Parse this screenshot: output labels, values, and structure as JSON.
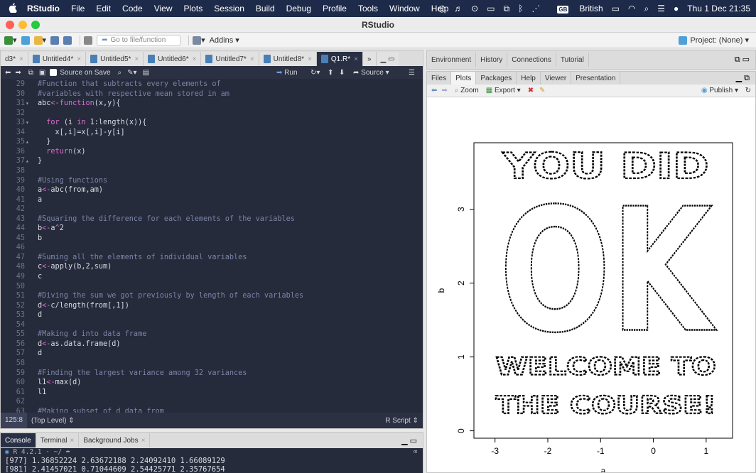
{
  "menubar": {
    "app": "RStudio",
    "items": [
      "File",
      "Edit",
      "Code",
      "View",
      "Plots",
      "Session",
      "Build",
      "Debug",
      "Profile",
      "Tools",
      "Window",
      "Help"
    ],
    "keyboard_badge": "GB",
    "keyboard": "British",
    "datetime": "Thu 1 Dec  21:35"
  },
  "window": {
    "title": "RStudio"
  },
  "toolbar": {
    "goto_placeholder": "Go to file/function",
    "addins": "Addins",
    "project": "Project: (None)"
  },
  "editor": {
    "tabs": [
      {
        "label": "d3*",
        "active": false
      },
      {
        "label": "Untitled4*",
        "active": false
      },
      {
        "label": "Untitled5*",
        "active": false
      },
      {
        "label": "Untitled6*",
        "active": false
      },
      {
        "label": "Untitled7*",
        "active": false
      },
      {
        "label": "Untitled8*",
        "active": false
      },
      {
        "label": "Q1.R*",
        "active": true
      }
    ],
    "more_tabs": "»",
    "source_on_save": "Source on Save",
    "run": "Run",
    "source": "Source",
    "lines": [
      {
        "n": "29",
        "text": "#Function that subtracts every elements of",
        "type": "cm"
      },
      {
        "n": "30",
        "text": "#variables with respective mean stored in am",
        "type": "cm"
      },
      {
        "n": "31",
        "text": "abc<-function(x,y){",
        "type": "fn",
        "fold": "▾"
      },
      {
        "n": "32",
        "text": "",
        "type": "plain"
      },
      {
        "n": "33",
        "text": "  for (i in 1:length(x)){",
        "type": "for",
        "fold": "▾"
      },
      {
        "n": "34",
        "text": "    x[,i]=x[,i]-y[i]",
        "type": "plain"
      },
      {
        "n": "35",
        "text": "  }",
        "type": "plain",
        "fold": "▴"
      },
      {
        "n": "36",
        "text": "  return(x)",
        "type": "plain"
      },
      {
        "n": "37",
        "text": "}",
        "type": "plain",
        "fold": "▴"
      },
      {
        "n": "38",
        "text": "",
        "type": "plain"
      },
      {
        "n": "39",
        "text": "#Using functions",
        "type": "cm"
      },
      {
        "n": "40",
        "text": "a<-abc(from,am)",
        "type": "plain"
      },
      {
        "n": "41",
        "text": "a",
        "type": "plain"
      },
      {
        "n": "42",
        "text": "",
        "type": "plain"
      },
      {
        "n": "43",
        "text": "#Squaring the difference for each elements of the variables",
        "type": "cm"
      },
      {
        "n": "44",
        "text": "b<-a^2",
        "type": "plain"
      },
      {
        "n": "45",
        "text": "b",
        "type": "plain"
      },
      {
        "n": "46",
        "text": "",
        "type": "plain"
      },
      {
        "n": "47",
        "text": "#Suming all the elements of individual variables",
        "type": "cm"
      },
      {
        "n": "48",
        "text": "c<-apply(b,2,sum)",
        "type": "plain"
      },
      {
        "n": "49",
        "text": "c",
        "type": "plain"
      },
      {
        "n": "50",
        "text": "",
        "type": "plain"
      },
      {
        "n": "51",
        "text": "#Diving the sum we got previously by length of each variables",
        "type": "cm"
      },
      {
        "n": "52",
        "text": "d<-c/length(from[,1])",
        "type": "plain"
      },
      {
        "n": "53",
        "text": "d",
        "type": "plain"
      },
      {
        "n": "54",
        "text": "",
        "type": "plain"
      },
      {
        "n": "55",
        "text": "#Making d into data frame",
        "type": "cm"
      },
      {
        "n": "56",
        "text": "d<-as.data.frame(d)",
        "type": "plain"
      },
      {
        "n": "57",
        "text": "d",
        "type": "plain"
      },
      {
        "n": "58",
        "text": "",
        "type": "plain"
      },
      {
        "n": "59",
        "text": "#Finding the largest variance among 32 variances",
        "type": "cm"
      },
      {
        "n": "60",
        "text": "l1<-max(d)",
        "type": "plain"
      },
      {
        "n": "61",
        "text": "l1",
        "type": "plain"
      },
      {
        "n": "62",
        "text": "",
        "type": "plain"
      },
      {
        "n": "63",
        "text": "#Making subset of d data from",
        "type": "cm"
      }
    ],
    "status": {
      "position": "125:8",
      "scope": "(Top Level)",
      "filetype": "R Script"
    }
  },
  "console": {
    "tabs": [
      "Console",
      "Terminal",
      "Background Jobs"
    ],
    "r_version": "R 4.2.1 · ~/",
    "lines": [
      "[977] 1.36852224 2.63672188 2.24092410 1.66089129",
      "[981] 2.41457021 0.71044609 2.54425771 2.35767654"
    ]
  },
  "env_tabs": [
    "Environment",
    "History",
    "Connections",
    "Tutorial"
  ],
  "files_tabs": [
    {
      "label": "Files",
      "active": false
    },
    {
      "label": "Plots",
      "active": true
    },
    {
      "label": "Packages",
      "active": false
    },
    {
      "label": "Help",
      "active": false
    },
    {
      "label": "Viewer",
      "active": false
    },
    {
      "label": "Presentation",
      "active": false
    }
  ],
  "plot_toolbar": {
    "zoom": "Zoom",
    "export": "Export",
    "publish": "Publish"
  },
  "chart_data": {
    "type": "scatter",
    "title": "",
    "xlabel": "a",
    "ylabel": "b",
    "xticks": [
      -3,
      -2,
      -1,
      0,
      1
    ],
    "yticks": [
      0,
      1,
      2,
      3
    ],
    "xlim": [
      -3.4,
      1.5
    ],
    "ylim": [
      -0.1,
      3.9
    ],
    "marker": "open-circle",
    "annotations": [
      "YOU DID",
      "OK",
      "WELCOME TO",
      "THE COURSE!"
    ]
  },
  "colors": {
    "editor_bg": "#262b3b",
    "menubar_bg": "#1d2a4a",
    "comment": "#7b84a6",
    "keyword": "#e06ad0"
  }
}
